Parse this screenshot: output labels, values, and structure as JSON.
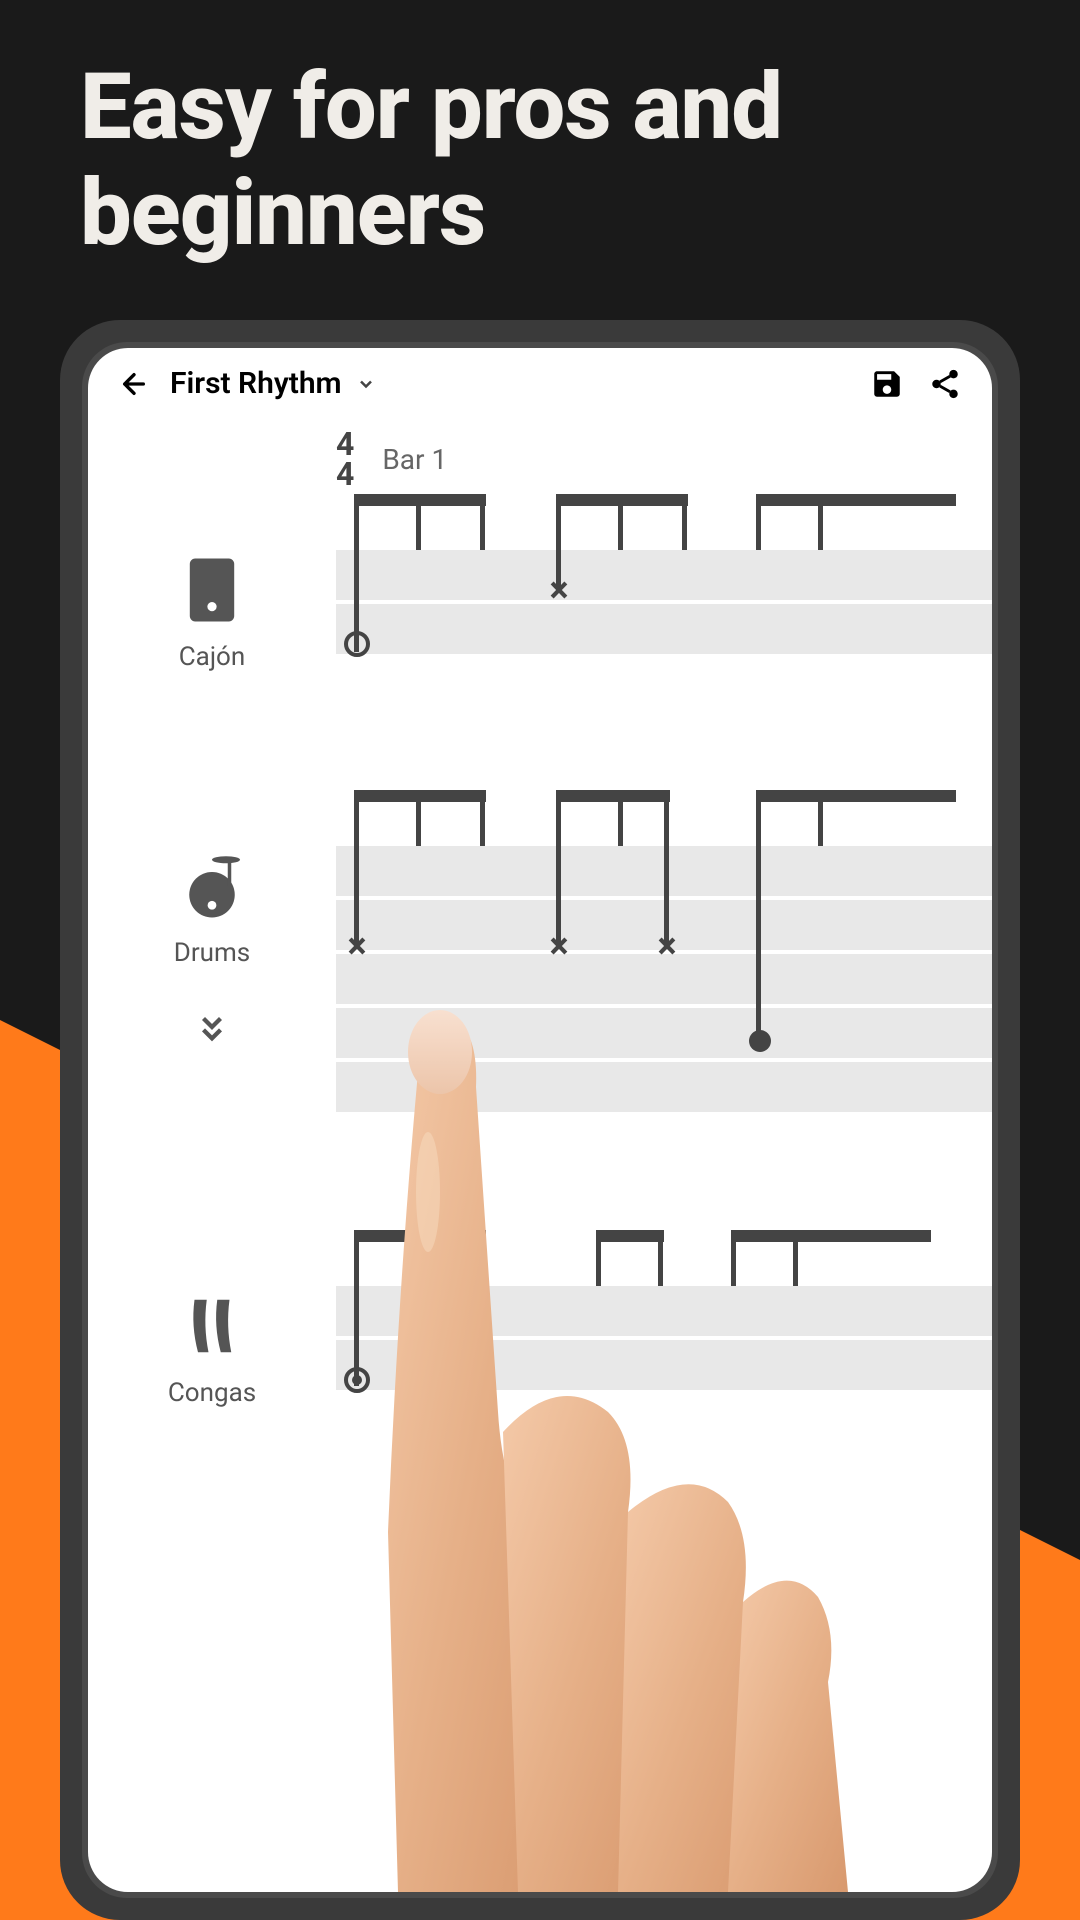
{
  "marketing": {
    "headline": "Easy for pros and beginners"
  },
  "header": {
    "title": "First Rhythm"
  },
  "bar": {
    "time_sig_top": "4",
    "time_sig_bottom": "4",
    "bar_label": "Bar 1"
  },
  "instruments": [
    {
      "name": "Cajón",
      "icon": "cajon"
    },
    {
      "name": "Drums",
      "icon": "drums"
    },
    {
      "name": "Congas",
      "icon": "congas"
    }
  ]
}
